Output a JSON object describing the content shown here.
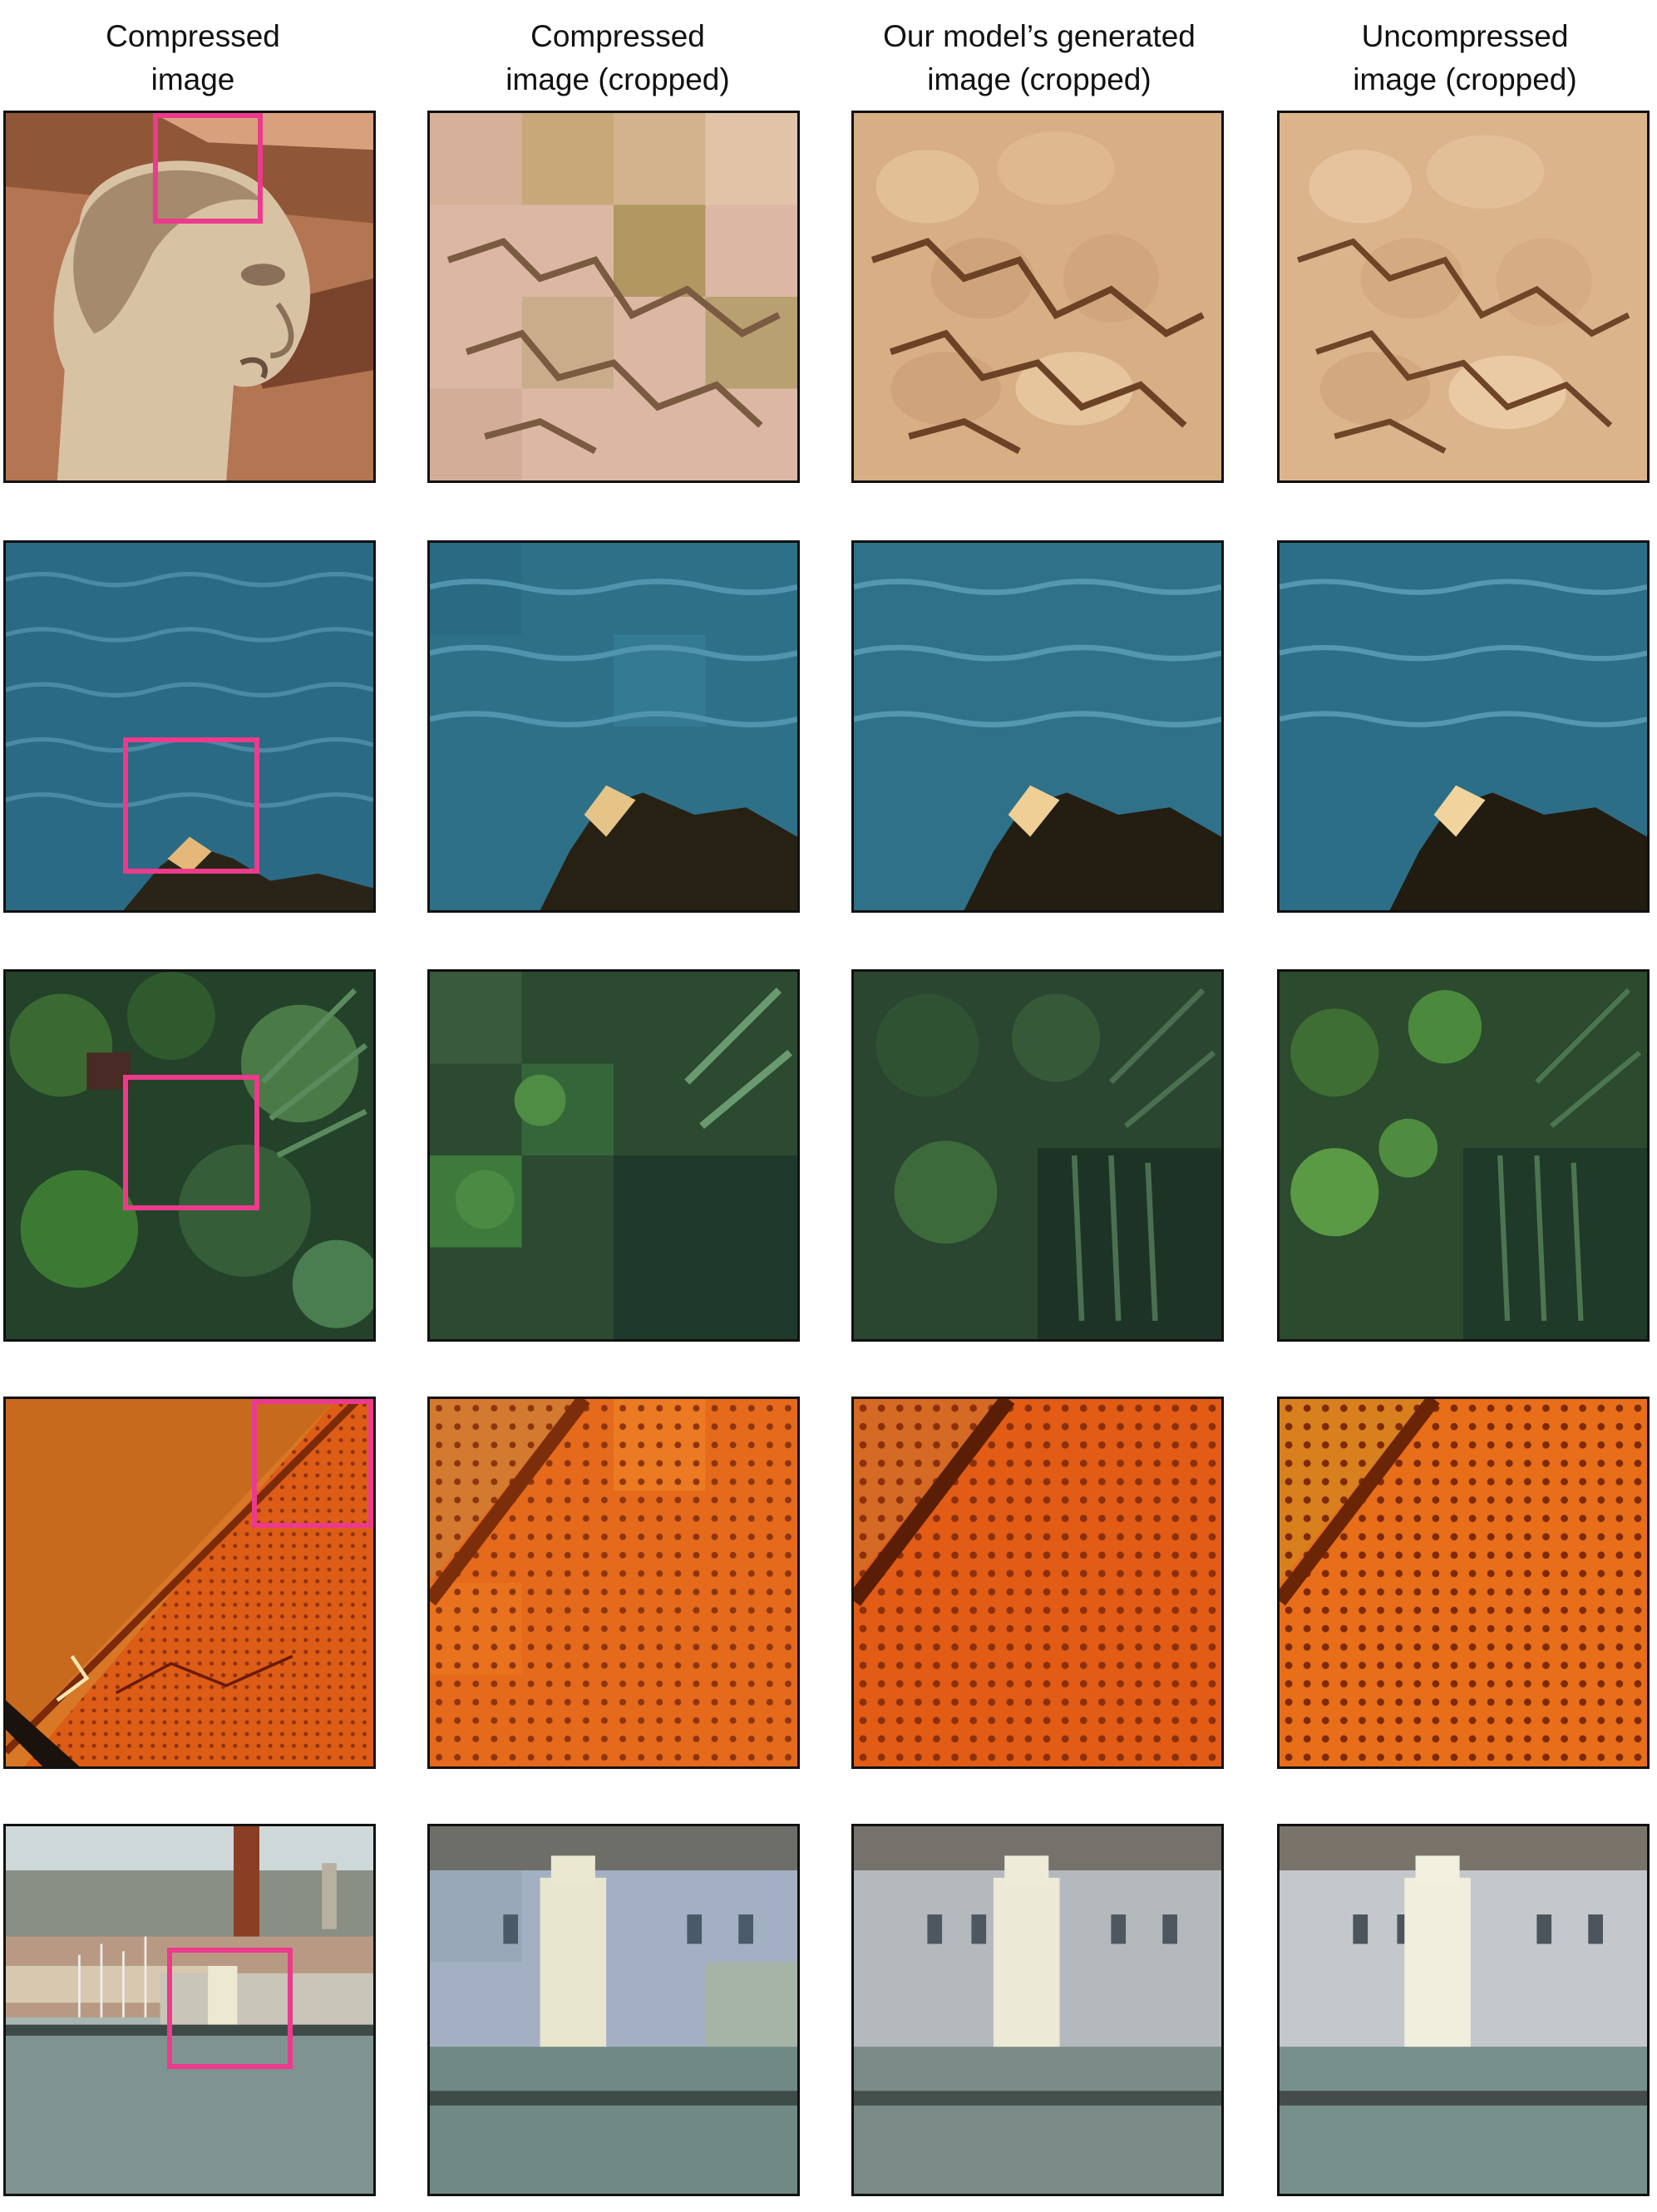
{
  "columns": [
    {
      "line1": "Compressed",
      "line2": "image"
    },
    {
      "line1": "Compressed",
      "line2": "image (cropped)"
    },
    {
      "line1": "Our model’s generated",
      "line2": "image (cropped)"
    },
    {
      "line1": "Uncompressed",
      "line2": "image (cropped)"
    }
  ],
  "rows": [
    {
      "subject": "statue-head",
      "colors": {
        "base": "#c9a07c",
        "dark": "#6e4a2e",
        "light": "#e8cba8",
        "accent": "#b98a6a"
      }
    },
    {
      "subject": "sea-and-rock",
      "colors": {
        "base": "#2d6f88",
        "dark": "#0f3446",
        "light": "#4f93ad",
        "accent": "#2a2418"
      }
    },
    {
      "subject": "foliage",
      "colors": {
        "base": "#2f5a2e",
        "dark": "#15281a",
        "light": "#5f9446",
        "accent": "#1d3327"
      }
    },
    {
      "subject": "orange-dotted-surface",
      "colors": {
        "base": "#e0641a",
        "dark": "#7a2a08",
        "light": "#f3a23c",
        "accent": "#b84410"
      }
    },
    {
      "subject": "harbor-lighthouse",
      "colors": {
        "base": "#98aab0",
        "dark": "#4c5b62",
        "light": "#e9e6d2",
        "accent": "#7e8d86"
      }
    }
  ],
  "highlight_color": "#ec3a8c"
}
